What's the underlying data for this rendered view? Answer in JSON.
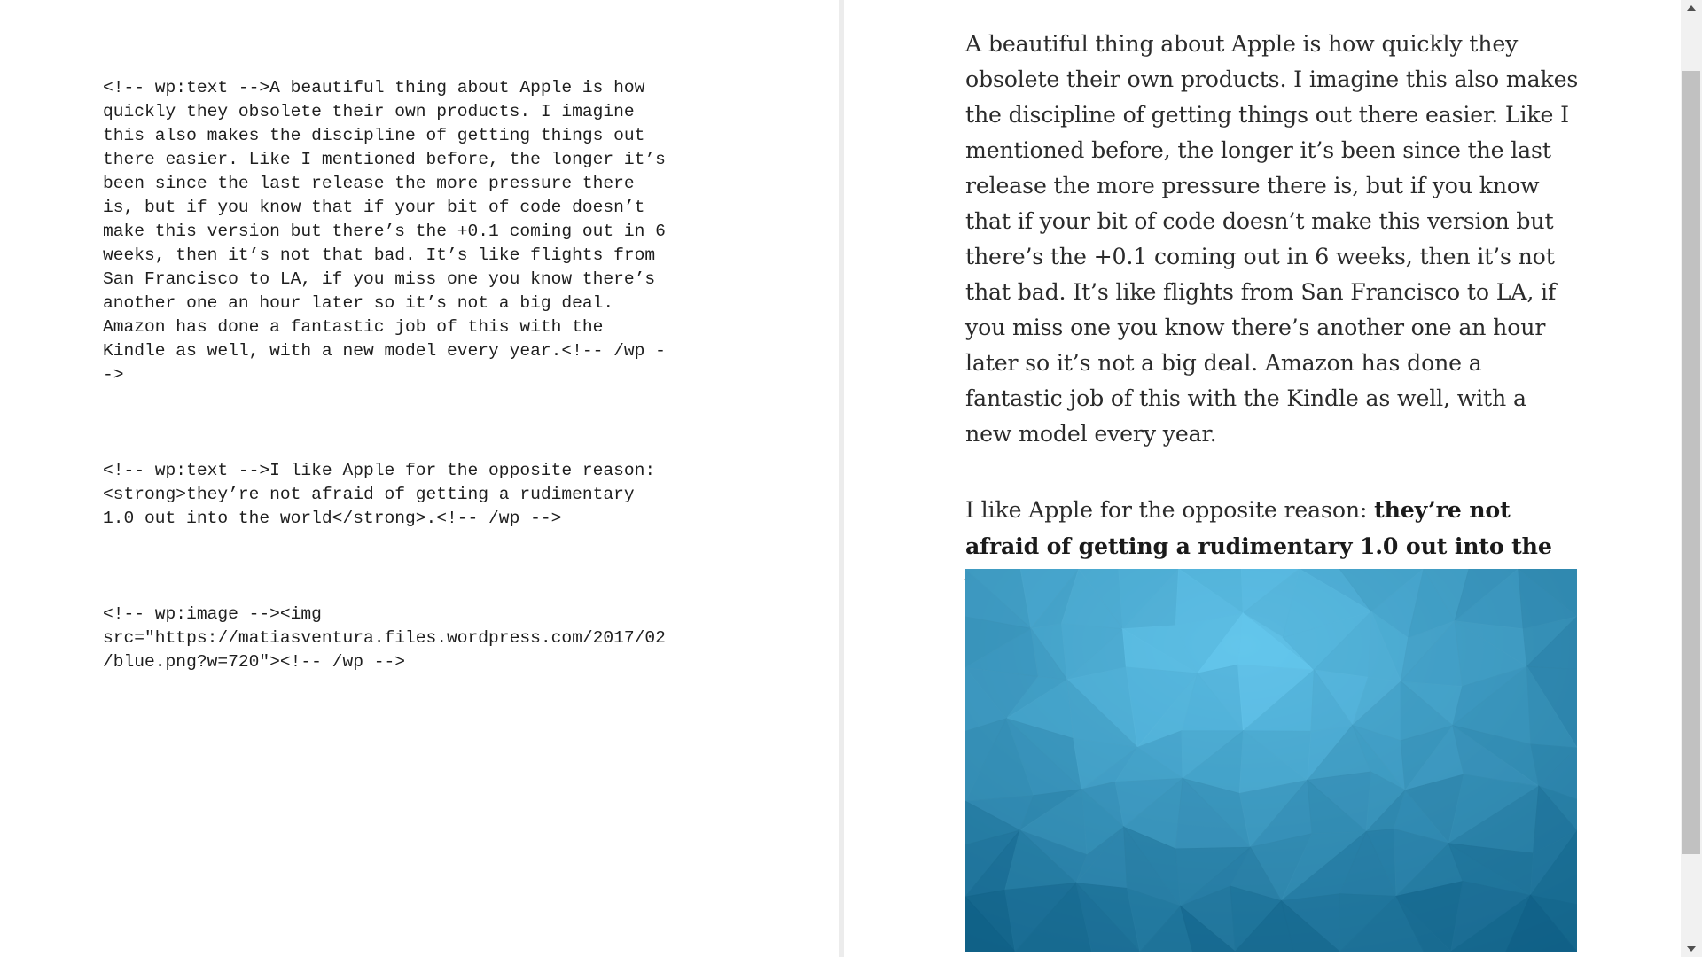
{
  "editor": {
    "blocks": [
      "<!-- wp:text -->A beautiful thing about Apple is how\nquickly they obsolete their own products. I imagine\nthis also makes the discipline of getting things out\nthere easier. Like I mentioned before, the longer it’s\nbeen since the last release the more pressure there\nis, but if you know that if your bit of code doesn’t\nmake this version but there’s the +0.1 coming out in 6\nweeks, then it’s not that bad. It’s like flights from\nSan Francisco to LA, if you miss one you know there’s\nanother one an hour later so it’s not a big deal.\nAmazon has done a fantastic job of this with the\nKindle as well, with a new model every year.<!-- /wp -\n->",
      "<!-- wp:text -->I like Apple for the opposite reason:\n<strong>they’re not afraid of getting a rudimentary\n1.0 out into the world</strong>.<!-- /wp -->",
      "<!-- wp:image --><img\nsrc=\"https://matiasventura.files.wordpress.com/2017/02\n/blue.png?w=720\"><!-- /wp -->"
    ]
  },
  "preview": {
    "paragraph1": "A beautiful thing about Apple is how quickly they obsolete their own products. I imagine this also makes the discipline of getting things out there easier. Like I mentioned before, the longer it’s been since the last release the more pressure there is, but if you know that if your bit of code doesn’t make this version but there’s the +0.1 coming out in 6 weeks, then it’s not that bad. It’s like flights from San Francisco to LA, if you miss one you know there’s another one an hour later so it’s not a big deal. Amazon has done a fantastic job of this with the Kindle as well, with a new model every year.",
    "paragraph2_lead": "I like Apple for the opposite reason: ",
    "paragraph2_strong": "they’re not afraid of getting a rudimentary 1.0 out into the world",
    "paragraph2_tail": ".",
    "image": {
      "icon": "blue-polygon-image",
      "colors": {
        "light": "#63c6ec",
        "mid": "#2f8fbd",
        "dark": "#0f5f85"
      }
    }
  },
  "scrollbar": {
    "up_icon": "triangle-up-icon",
    "down_icon": "triangle-down-icon"
  }
}
